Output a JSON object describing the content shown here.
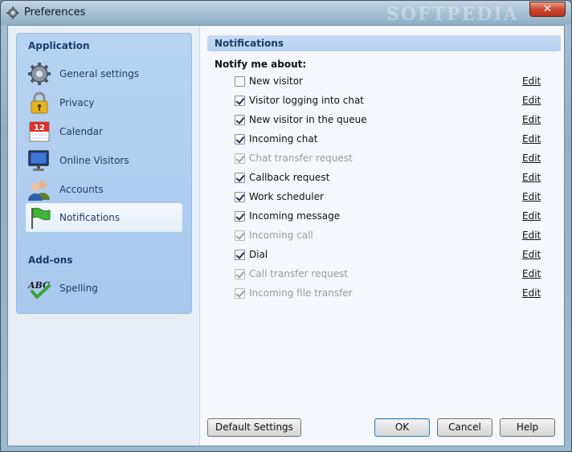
{
  "window": {
    "title": "Preferences",
    "watermark": "SOFTPEDIA",
    "close_glyph": "✕"
  },
  "sidebar": {
    "sections": [
      {
        "heading": "Application",
        "items": [
          {
            "label": "General settings",
            "icon": "gear-icon"
          },
          {
            "label": "Privacy",
            "icon": "lock-icon"
          },
          {
            "label": "Calendar",
            "icon": "calendar-icon",
            "badge": "12"
          },
          {
            "label": "Online Visitors",
            "icon": "monitor-icon"
          },
          {
            "label": "Accounts",
            "icon": "users-icon"
          },
          {
            "label": "Notifications",
            "icon": "flag-icon",
            "selected": true
          }
        ]
      },
      {
        "heading": "Add-ons",
        "items": [
          {
            "label": "Spelling",
            "icon": "spellcheck-icon",
            "glyph": "ABC"
          }
        ]
      }
    ]
  },
  "main": {
    "header": "Notifications",
    "notify_label": "Notify me about:",
    "edit_label": "Edit",
    "rows": [
      {
        "label": "New visitor",
        "checked": false,
        "enabled": true
      },
      {
        "label": "Visitor logging into chat",
        "checked": true,
        "enabled": true
      },
      {
        "label": "New visitor in the queue",
        "checked": true,
        "enabled": true
      },
      {
        "label": "Incoming chat",
        "checked": true,
        "enabled": true
      },
      {
        "label": "Chat transfer request",
        "checked": true,
        "enabled": false
      },
      {
        "label": "Callback request",
        "checked": true,
        "enabled": true
      },
      {
        "label": "Work scheduler",
        "checked": true,
        "enabled": true
      },
      {
        "label": "Incoming message",
        "checked": true,
        "enabled": true
      },
      {
        "label": "Incoming call",
        "checked": true,
        "enabled": false
      },
      {
        "label": "Dial",
        "checked": true,
        "enabled": true
      },
      {
        "label": "Call transfer request",
        "checked": true,
        "enabled": false
      },
      {
        "label": "Incoming file transfer",
        "checked": true,
        "enabled": false
      }
    ]
  },
  "buttons": {
    "default_settings": "Default Settings",
    "ok": "OK",
    "cancel": "Cancel",
    "help": "Help"
  },
  "colors": {
    "accent": "#1b3c6b",
    "sidebar_bg": "#a8c8ee",
    "header_bg": "#b6d0ee"
  }
}
